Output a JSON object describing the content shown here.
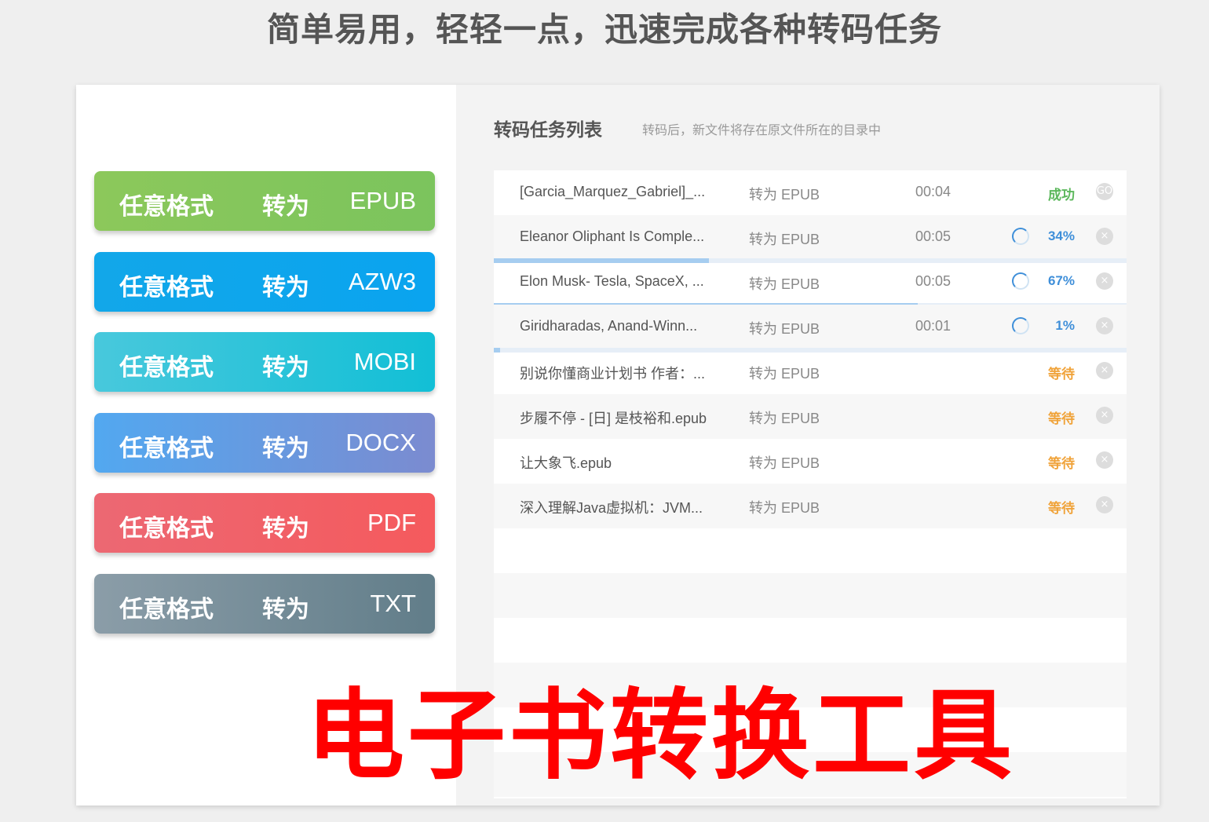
{
  "headline": "简单易用，轻轻一点，迅速完成各种转码任务",
  "formats": [
    {
      "left": "任意格式",
      "mid": "转为",
      "fmt": "EPUB",
      "color_from": "#8cc85b",
      "color_to": "#7bc45d"
    },
    {
      "left": "任意格式",
      "mid": "转为",
      "fmt": "AZW3",
      "color_from": "#12a7e9",
      "color_to": "#0aa4ef"
    },
    {
      "left": "任意格式",
      "mid": "转为",
      "fmt": "MOBI",
      "color_from": "#48c8dc",
      "color_to": "#12bfd6"
    },
    {
      "left": "任意格式",
      "mid": "转为",
      "fmt": "DOCX",
      "color_from": "#52a8f0",
      "color_to": "#7b8bd0"
    },
    {
      "left": "任意格式",
      "mid": "转为",
      "fmt": "PDF",
      "color_from": "#ec6873",
      "color_to": "#f55a5d"
    },
    {
      "left": "任意格式",
      "mid": "转为",
      "fmt": "TXT",
      "color_from": "#8b9da8",
      "color_to": "#617d89"
    }
  ],
  "tasks_panel": {
    "title": "转码任务列表",
    "subtitle": "转码后，新文件将存在原文件所在的目录中"
  },
  "tasks": [
    {
      "name": "[Garcia_Marquez_Gabriel]_...",
      "conv": "转为 EPUB",
      "time": "00:04",
      "status": "成功",
      "status_color": "#5cb85c",
      "spinner": false,
      "progress": null,
      "close": "GO"
    },
    {
      "name": "Eleanor Oliphant Is Comple...",
      "conv": "转为 EPUB",
      "time": "00:05",
      "status": "34%",
      "status_color": "#3f8fd9",
      "spinner": true,
      "progress": 0.34,
      "close": "×"
    },
    {
      "name": "Elon Musk- Tesla, SpaceX, ...",
      "conv": "转为 EPUB",
      "time": "00:05",
      "status": "67%",
      "status_color": "#3f8fd9",
      "spinner": true,
      "progress": 0.67,
      "close": "×"
    },
    {
      "name": "Giridharadas, Anand-Winn...",
      "conv": "转为 EPUB",
      "time": "00:01",
      "status": "1%",
      "status_color": "#3f8fd9",
      "spinner": true,
      "progress": 0.01,
      "close": "×"
    },
    {
      "name": "别说你懂商业计划书 作者：...",
      "conv": "转为 EPUB",
      "time": "",
      "status": "等待",
      "status_color": "#f0a33a",
      "spinner": false,
      "progress": null,
      "close": "×"
    },
    {
      "name": "步履不停 - [日] 是枝裕和.epub",
      "conv": "转为 EPUB",
      "time": "",
      "status": "等待",
      "status_color": "#f0a33a",
      "spinner": false,
      "progress": null,
      "close": "×"
    },
    {
      "name": "让大象飞.epub",
      "conv": "转为 EPUB",
      "time": "",
      "status": "等待",
      "status_color": "#f0a33a",
      "spinner": false,
      "progress": null,
      "close": "×"
    },
    {
      "name": "深入理解Java虚拟机：JVM...",
      "conv": "转为 EPUB",
      "time": "",
      "status": "等待",
      "status_color": "#f0a33a",
      "spinner": false,
      "progress": null,
      "close": "×"
    }
  ],
  "overlay_title": "电子书转换工具"
}
